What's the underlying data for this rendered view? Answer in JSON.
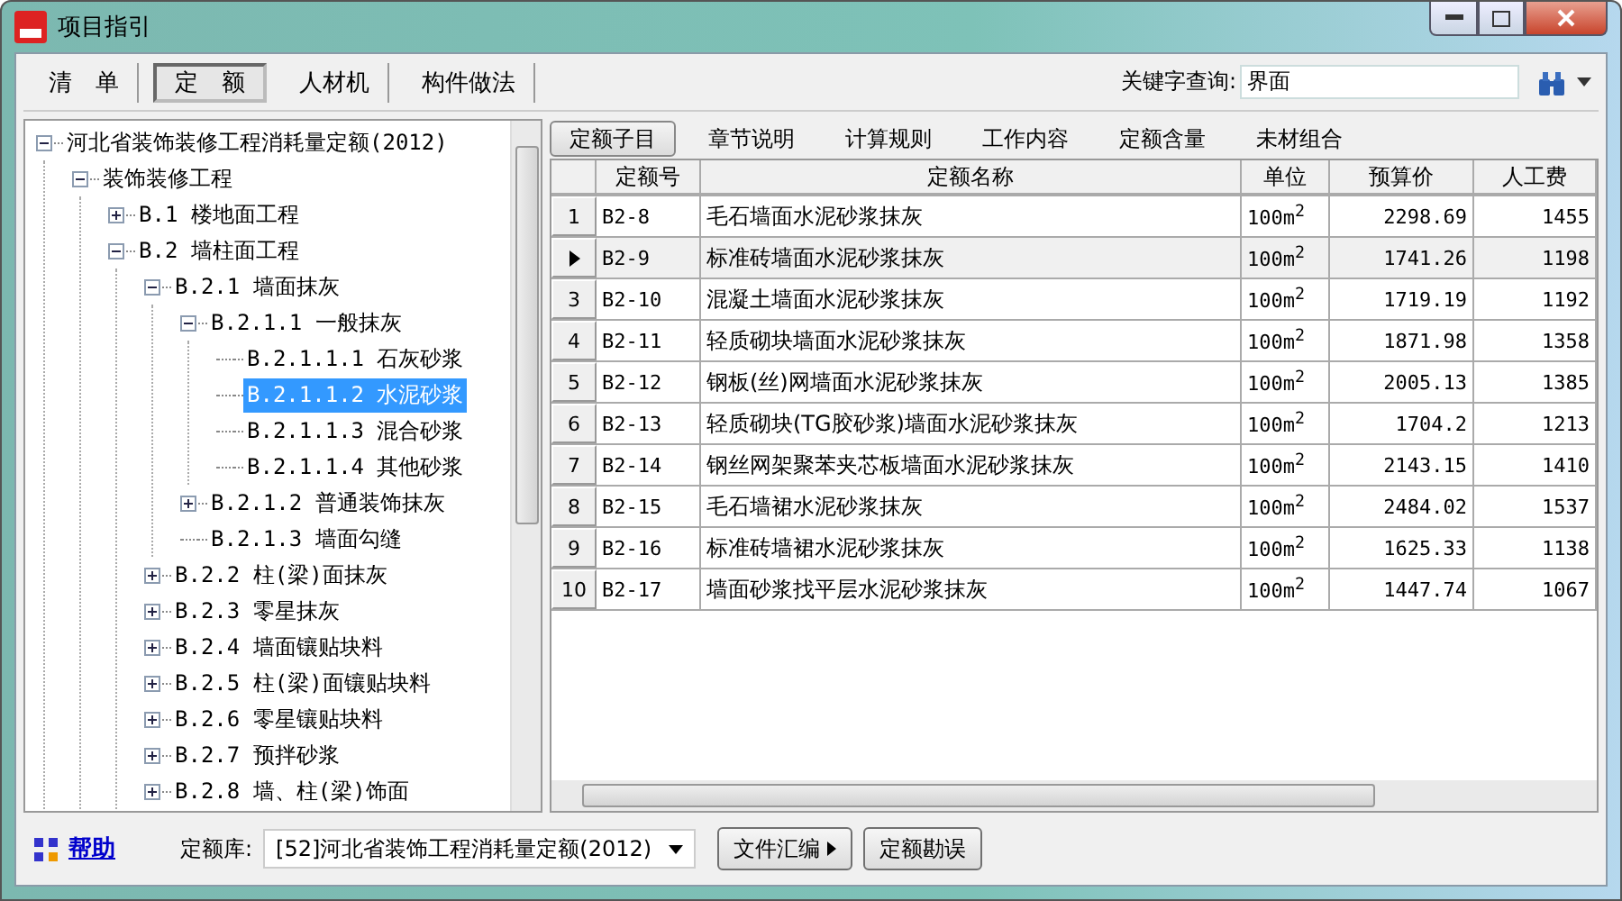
{
  "window": {
    "title": "项目指引"
  },
  "top_tabs": [
    {
      "label": "清　单",
      "selected": false
    },
    {
      "label": "定　额",
      "selected": true
    },
    {
      "label": "人材机",
      "selected": false
    },
    {
      "label": "构件做法",
      "selected": false
    }
  ],
  "search": {
    "label": "关键字查询:",
    "value": "界面"
  },
  "tree": [
    {
      "label": "河北省装饰装修工程消耗量定额(2012)",
      "expanded": true,
      "selected": false,
      "children": [
        {
          "label": "装饰装修工程",
          "expanded": true,
          "selected": false,
          "children": [
            {
              "label": "B.1 楼地面工程",
              "expanded": false,
              "selected": false
            },
            {
              "label": "B.2 墙柱面工程",
              "expanded": true,
              "selected": false,
              "children": [
                {
                  "label": "B.2.1 墙面抹灰",
                  "expanded": true,
                  "selected": false,
                  "children": [
                    {
                      "label": "B.2.1.1 一般抹灰",
                      "expanded": true,
                      "selected": false,
                      "children": [
                        {
                          "label": "B.2.1.1.1 石灰砂浆",
                          "selected": false
                        },
                        {
                          "label": "B.2.1.1.2 水泥砂浆",
                          "selected": true
                        },
                        {
                          "label": "B.2.1.1.3 混合砂浆",
                          "selected": false
                        },
                        {
                          "label": "B.2.1.1.4 其他砂浆",
                          "selected": false
                        }
                      ]
                    },
                    {
                      "label": "B.2.1.2 普通装饰抹灰",
                      "expanded": false,
                      "selected": false
                    },
                    {
                      "label": "B.2.1.3 墙面勾缝",
                      "selected": false
                    }
                  ]
                },
                {
                  "label": "B.2.2 柱(梁)面抹灰",
                  "expanded": false,
                  "selected": false
                },
                {
                  "label": "B.2.3 零星抹灰",
                  "expanded": false,
                  "selected": false
                },
                {
                  "label": "B.2.4 墙面镶贴块料",
                  "expanded": false,
                  "selected": false
                },
                {
                  "label": "B.2.5 柱(梁)面镶贴块料",
                  "expanded": false,
                  "selected": false
                },
                {
                  "label": "B.2.6 零星镶贴块料",
                  "expanded": false,
                  "selected": false
                },
                {
                  "label": "B.2.7 预拌砂浆",
                  "expanded": false,
                  "selected": false
                },
                {
                  "label": "B.2.8 墙、柱(梁)饰面",
                  "expanded": false,
                  "selected": false
                }
              ]
            }
          ]
        }
      ]
    }
  ],
  "detail_tabs": [
    {
      "label": "定额子目",
      "selected": true
    },
    {
      "label": "章节说明",
      "selected": false
    },
    {
      "label": "计算规则",
      "selected": false
    },
    {
      "label": "工作内容",
      "selected": false
    },
    {
      "label": "定额含量",
      "selected": false
    },
    {
      "label": "未材组合",
      "selected": false
    }
  ],
  "table": {
    "columns": [
      "定额号",
      "定额名称",
      "单位",
      "预算价",
      "人工费"
    ],
    "rows": [
      {
        "number": "1",
        "current": false,
        "cells": [
          "B2-8",
          "毛石墙面水泥砂浆抹灰",
          "100m$^{2}$",
          "2298.69",
          "1455"
        ]
      },
      {
        "current": true,
        "cells": [
          "B2-9",
          "标准砖墙面水泥砂浆抹灰",
          "100m$^{2}$",
          "1741.26",
          "1198"
        ]
      },
      {
        "number": "3",
        "current": false,
        "cells": [
          "B2-10",
          "混凝土墙面水泥砂浆抹灰",
          "100m$^{2}$",
          "1719.19",
          "1192"
        ]
      },
      {
        "number": "4",
        "current": false,
        "cells": [
          "B2-11",
          "轻质砌块墙面水泥砂浆抹灰",
          "100m$^{2}$",
          "1871.98",
          "1358"
        ]
      },
      {
        "number": "5",
        "current": false,
        "cells": [
          "B2-12",
          "钢板(丝)网墙面水泥砂浆抹灰",
          "100m$^{2}$",
          "2005.13",
          "1385"
        ]
      },
      {
        "number": "6",
        "current": false,
        "cells": [
          "B2-13",
          "轻质砌块(TG胶砂浆)墙面水泥砂浆抹灰",
          "100m$^{2}$",
          "1704.2",
          "1213"
        ]
      },
      {
        "number": "7",
        "current": false,
        "cells": [
          "B2-14",
          "钢丝网架聚苯夹芯板墙面水泥砂浆抹灰",
          "100m$^{2}$",
          "2143.15",
          "1410"
        ]
      },
      {
        "number": "8",
        "current": false,
        "cells": [
          "B2-15",
          "毛石墙裙水泥砂浆抹灰",
          "100m$^{2}$",
          "2484.02",
          "1537"
        ]
      },
      {
        "number": "9",
        "current": false,
        "cells": [
          "B2-16",
          "标准砖墙裙水泥砂浆抹灰",
          "100m$^{2}$",
          "1625.33",
          "1138"
        ]
      },
      {
        "number": "10",
        "current": false,
        "cells": [
          "B2-17",
          "墙面砂浆找平层水泥砂浆抹灰",
          "100m$^{2}$",
          "1447.74",
          "1067"
        ]
      }
    ]
  },
  "bottom": {
    "help": "帮助",
    "library_label": "定额库:",
    "library_value": "[52]河北省装饰工程消耗量定额(2012)",
    "buttons": [
      "文件汇编",
      "定额勘误"
    ]
  }
}
